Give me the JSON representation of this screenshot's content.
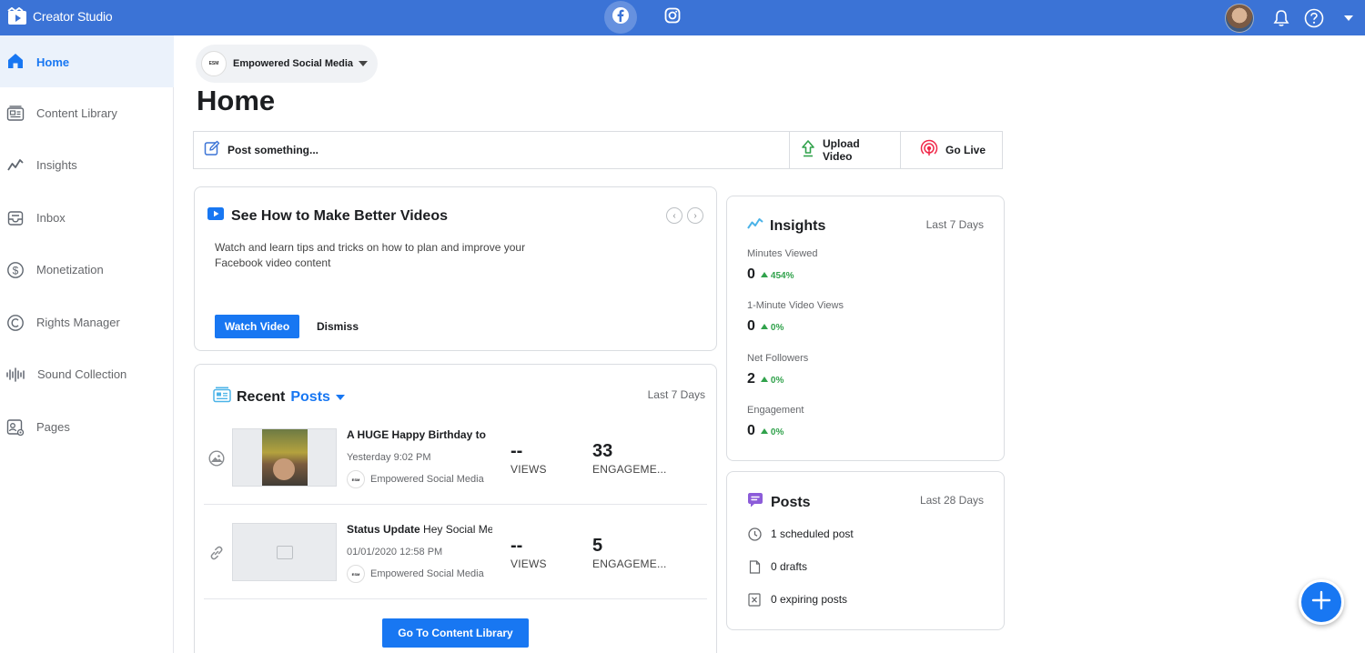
{
  "topbar": {
    "app_title": "Creator Studio",
    "icons": [
      "creator-studio-logo-icon",
      "facebook-icon",
      "instagram-icon",
      "notifications-bell-icon",
      "help-icon",
      "caret-down-icon"
    ]
  },
  "sidebar": {
    "items": [
      {
        "label": "Home",
        "icon": "home-icon",
        "active": true
      },
      {
        "label": "Content Library",
        "icon": "content-library-icon"
      },
      {
        "label": "Insights",
        "icon": "insights-icon"
      },
      {
        "label": "Inbox",
        "icon": "inbox-icon"
      },
      {
        "label": "Monetization",
        "icon": "monetization-icon"
      },
      {
        "label": "Rights Manager",
        "icon": "rights-manager-icon"
      },
      {
        "label": "Sound Collection",
        "icon": "sound-collection-icon"
      },
      {
        "label": "Pages",
        "icon": "pages-icon"
      }
    ]
  },
  "page_selector": {
    "name": "Empowered Social Media"
  },
  "main": {
    "title": "Home"
  },
  "composer": {
    "post_label": "Post something...",
    "upload_label": "Upload Video",
    "live_label": "Go Live"
  },
  "videos_card": {
    "title": "See How to Make Better Videos",
    "description": "Watch and learn tips and tricks on how to plan and improve your Facebook video content",
    "watch_label": "Watch Video",
    "dismiss_label": "Dismiss"
  },
  "recent_posts": {
    "title": "Recent",
    "filter": "Posts",
    "range": "Last 7 Days",
    "posts": [
      {
        "title_bold": "A HUGE Happy Birthday to",
        "title_rest": "",
        "time": "Yesterday 9:02 PM",
        "page": "Empowered Social Media",
        "views": "--",
        "views_label": "VIEWS",
        "engagement": "33",
        "engagement_label": "ENGAGEME..."
      },
      {
        "title_bold": "Status Update",
        "title_rest": " Hey Social Me",
        "time": "01/01/2020 12:58 PM",
        "page": "Empowered Social Media",
        "views": "--",
        "views_label": "VIEWS",
        "engagement": "5",
        "engagement_label": "ENGAGEME..."
      }
    ],
    "goto_label": "Go To Content Library"
  },
  "insights": {
    "title": "Insights",
    "range": "Last 7 Days",
    "stats": [
      {
        "label": "Minutes Viewed",
        "value": "0",
        "change": "454%"
      },
      {
        "label": "1-Minute Video Views",
        "value": "0",
        "change": "0%"
      },
      {
        "label": "Net Followers",
        "value": "2",
        "change": "0%"
      },
      {
        "label": "Engagement",
        "value": "0",
        "change": "0%"
      }
    ]
  },
  "posts_summary": {
    "title": "Posts",
    "range": "Last 28 Days",
    "items": [
      {
        "text": "1 scheduled post",
        "icon": "clock-icon"
      },
      {
        "text": "0 drafts",
        "icon": "draft-icon"
      },
      {
        "text": "0 expiring posts",
        "icon": "expiring-icon"
      }
    ]
  },
  "colors": {
    "topbar": "#3b73d6",
    "accent": "#1877f2",
    "positive": "#31a24c"
  }
}
